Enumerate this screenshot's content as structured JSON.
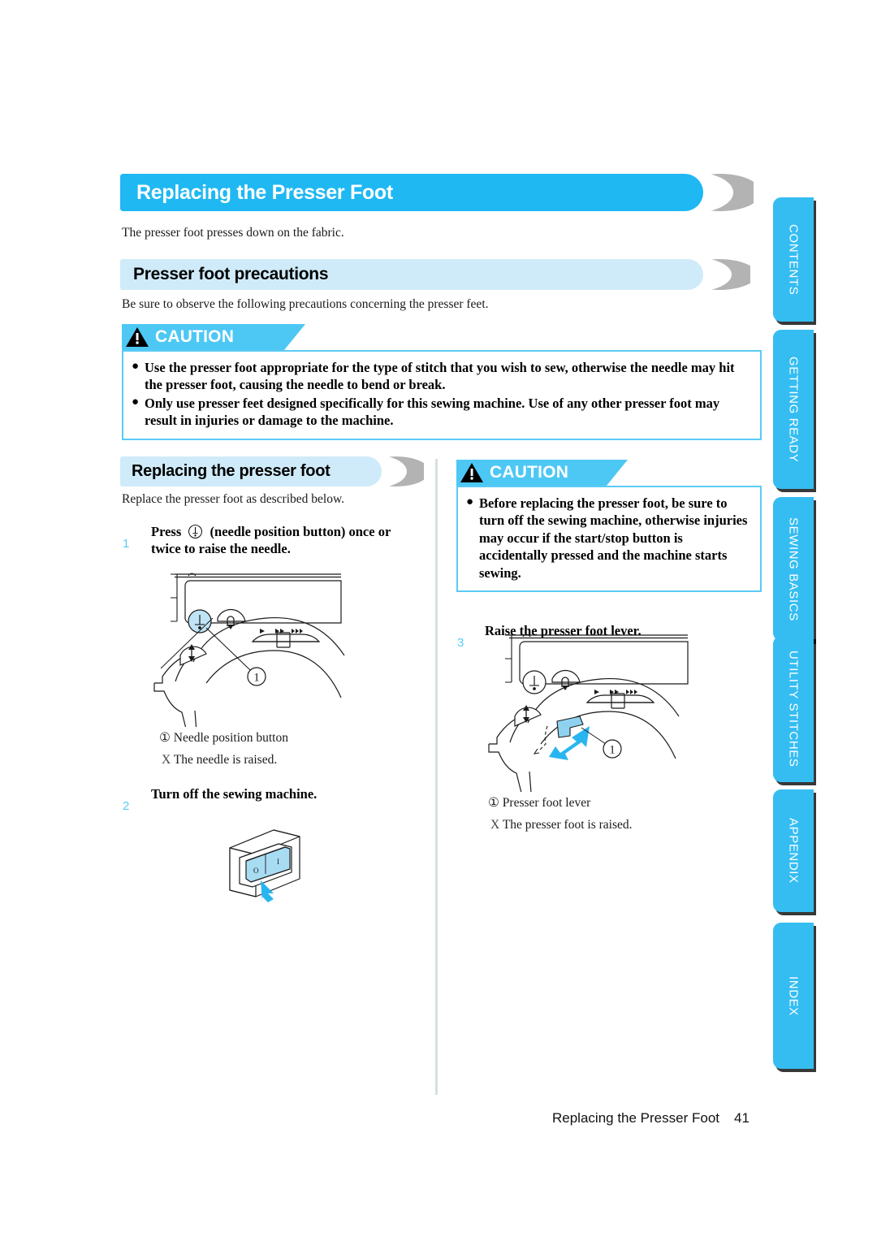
{
  "page": {
    "title": "Replacing the Presser Foot",
    "intro": "The presser foot presses down on the fabric.",
    "footer_title": "Replacing the Presser Foot",
    "footer_page": "41"
  },
  "section_precautions": {
    "heading": "Presser foot precautions",
    "intro": "Be sure to observe the following precautions concerning the presser feet."
  },
  "caution_main": {
    "label": "CAUTION",
    "bullet_glyph": "●",
    "items": [
      "Use the presser foot appropriate for the type of stitch that you wish to sew, otherwise the needle may hit the presser foot, causing the needle to bend or break.",
      "Only use presser feet designed specifically for this sewing machine. Use of any other presser foot may result in injuries or damage to the machine."
    ]
  },
  "section_replacing": {
    "heading": "Replacing the presser foot",
    "intro": "Replace the presser foot as described below."
  },
  "caution_right": {
    "label": "CAUTION",
    "bullet_glyph": "●",
    "items": [
      "Before replacing the presser foot, be sure to turn off the sewing machine, otherwise injuries may occur if the start/stop button is accidentally pressed and the machine starts sewing."
    ]
  },
  "steps": [
    {
      "number": "1",
      "title_before": "Press",
      "title_after": "(needle position button) once or twice to raise the needle.",
      "callout_number": "①",
      "callout_label": "Needle position button",
      "result_marker": "X",
      "result": "The needle is raised."
    },
    {
      "number": "2",
      "title": "Turn off the sewing machine.",
      "switch_off_label": "O",
      "switch_on_label": "I"
    },
    {
      "number": "3",
      "title": "Raise the presser foot lever.",
      "callout_number": "①",
      "callout_label": "Presser foot lever",
      "result_marker": "X",
      "result": "The presser foot is raised."
    }
  ],
  "index_tabs": [
    {
      "label": "CONTENTS"
    },
    {
      "label": "GETTING READY"
    },
    {
      "label": "SEWING BASICS"
    },
    {
      "label": "UTILITY STITCHES"
    },
    {
      "label": "APPENDIX"
    },
    {
      "label": "INDEX"
    }
  ],
  "colors": {
    "accent_blue": "#1FB8F2",
    "light_blue": "#CFEBFA",
    "caution_blue": "#4DC8F5",
    "tab_blue": "#35BDF2",
    "grey_crescent": "#B3B3B3"
  }
}
